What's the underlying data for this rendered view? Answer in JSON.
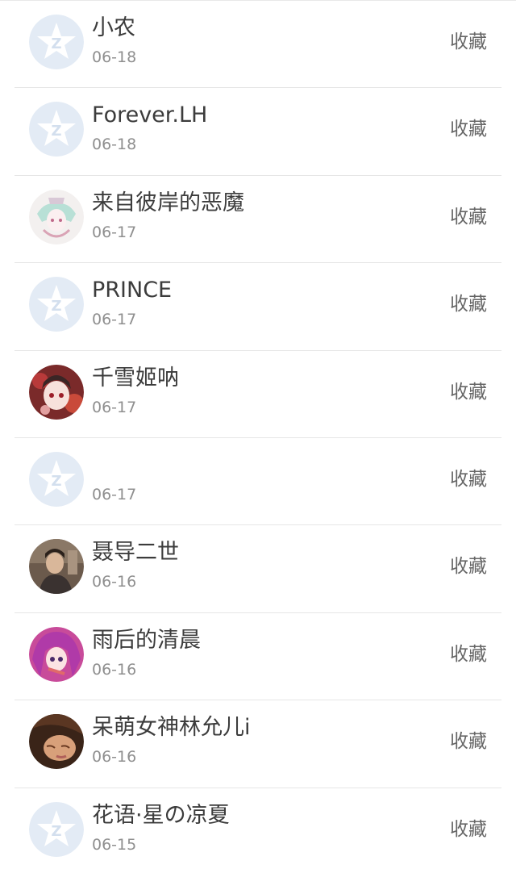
{
  "rows": [
    {
      "name": "小农",
      "date": "06-18",
      "action": "收藏",
      "avatar": "default-qzone-icon"
    },
    {
      "name": "Forever.LH",
      "date": "06-18",
      "action": "收藏",
      "avatar": "default-qzone-icon"
    },
    {
      "name": "来自彼岸的恶魔",
      "date": "06-17",
      "action": "收藏",
      "avatar": "anime-sketch-avatar"
    },
    {
      "name": "PRINCE",
      "date": "06-17",
      "action": "收藏",
      "avatar": "default-qzone-icon"
    },
    {
      "name": "千雪姬呐",
      "date": "06-17",
      "action": "收藏",
      "avatar": "anime-girl-red-avatar"
    },
    {
      "name": "",
      "date": "06-17",
      "action": "收藏",
      "avatar": "default-qzone-icon"
    },
    {
      "name": "聂导二世",
      "date": "06-16",
      "action": "收藏",
      "avatar": "photo-man-avatar"
    },
    {
      "name": "雨后的清晨",
      "date": "06-16",
      "action": "收藏",
      "avatar": "anime-pink-hair-avatar"
    },
    {
      "name": "呆萌女神林允儿i",
      "date": "06-16",
      "action": "收藏",
      "avatar": "photo-woman-avatar"
    },
    {
      "name": "花语·星の凉夏",
      "date": "06-15",
      "action": "收藏",
      "avatar": "default-qzone-icon"
    }
  ]
}
